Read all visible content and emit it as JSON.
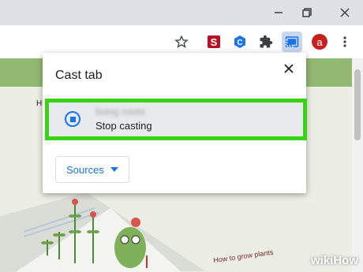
{
  "window": {
    "minimize_icon": "minimize-icon",
    "restore_icon": "restore-icon",
    "close_icon": "close-icon"
  },
  "toolbar": {
    "icons": [
      "bookmark-star-icon",
      "extension-s-icon",
      "extension-c-icon",
      "extensions-puzzle-icon",
      "cast-icon",
      "avatar",
      "more-vert-icon"
    ],
    "avatar_letter": "a"
  },
  "dialog": {
    "title": "Cast tab",
    "device": {
      "name": "living room",
      "status": "Stop casting"
    },
    "sources_label": "Sources"
  },
  "background": {
    "page_text_fragment": "H",
    "book_text": "How to grow plants"
  },
  "watermark": {
    "prefix": "wiki",
    "suffix": "How"
  },
  "colors": {
    "highlight": "#39d316",
    "accent": "#1a73e8",
    "avatar": "#c5221f"
  }
}
